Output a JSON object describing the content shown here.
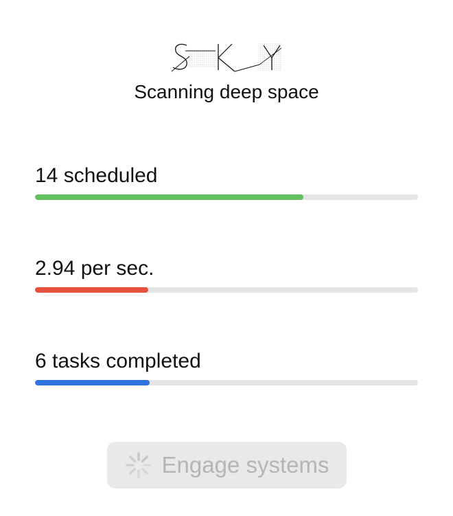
{
  "header": {
    "logo_text": "SKY",
    "subtitle": "Scanning deep space"
  },
  "stats": {
    "scheduled": {
      "label": "14 scheduled",
      "fraction": 0.7,
      "color": "#63bf5f"
    },
    "rate": {
      "label": "2.94 per sec.",
      "fraction": 0.295,
      "color": "#e8503e"
    },
    "completed": {
      "label": "6 tasks completed",
      "fraction": 0.3,
      "color": "#2f73e0"
    }
  },
  "action": {
    "label": "Engage systems",
    "state": "disabled-loading",
    "icon": "spinner-icon"
  },
  "colors": {
    "track": "#e5e5e5",
    "button_bg": "#e9e9e9",
    "button_text": "#b5b5b5"
  }
}
